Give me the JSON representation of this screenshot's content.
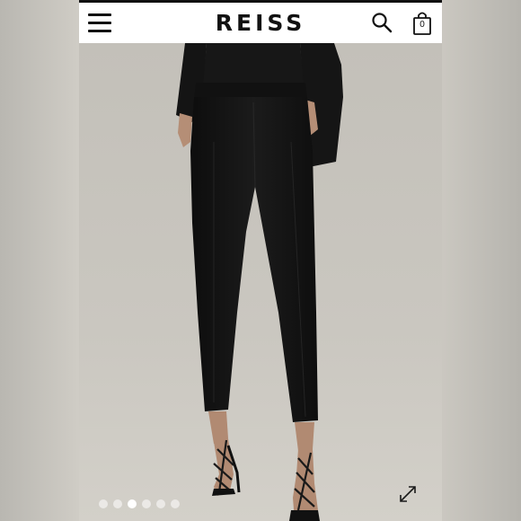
{
  "header": {
    "brand": "REISS",
    "menu_icon": "hamburger-menu-icon",
    "search_icon": "search-icon",
    "bag_icon": "shopping-bag-icon",
    "bag_count": "0"
  },
  "gallery": {
    "image_count": 6,
    "active_index": 2,
    "expand_icon": "expand-icon"
  },
  "colors": {
    "background": "#c8c5be",
    "trousers": "#141414",
    "header": "#ffffff"
  }
}
